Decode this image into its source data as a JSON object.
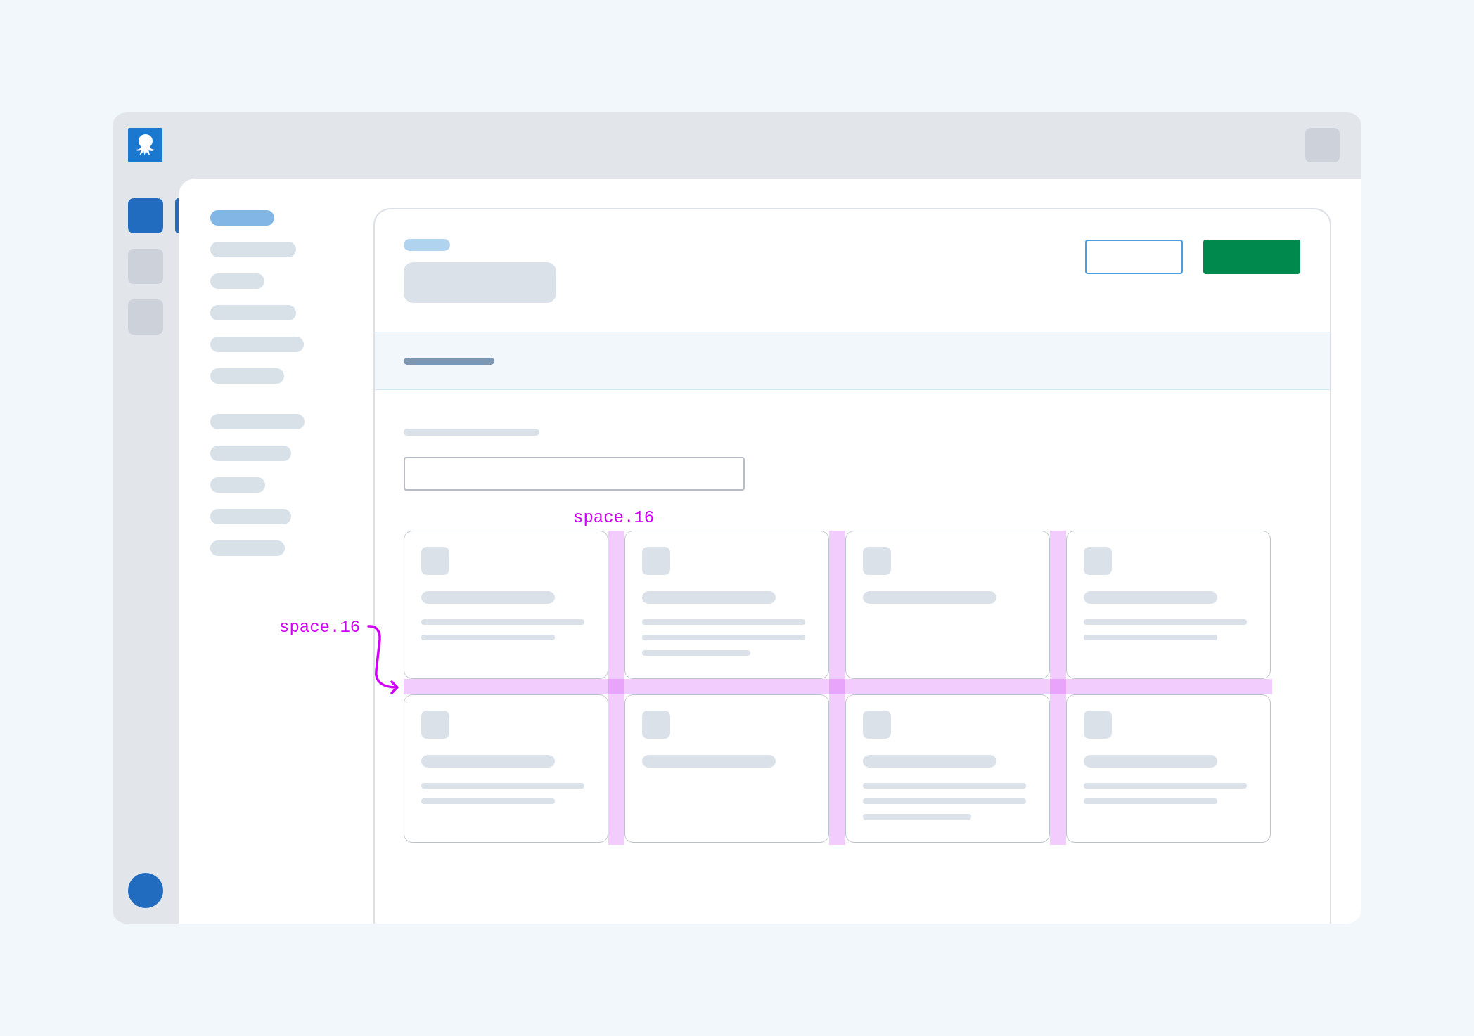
{
  "rail": {
    "items": [
      {
        "selected": true
      },
      {
        "selected": false
      },
      {
        "selected": false
      }
    ]
  },
  "sidebar": {
    "groups": [
      {
        "items": [
          {
            "selected": true
          },
          {
            "selected": false
          },
          {
            "selected": false
          },
          {
            "selected": false
          },
          {
            "selected": false
          },
          {
            "selected": false
          }
        ]
      },
      {
        "items": [
          {
            "selected": false
          },
          {
            "selected": false
          },
          {
            "selected": false
          },
          {
            "selected": false
          },
          {
            "selected": false
          }
        ]
      }
    ]
  },
  "main": {
    "cards": [
      {
        "kind": "short"
      },
      {
        "kind": "long"
      },
      {
        "kind": "bare"
      },
      {
        "kind": "short"
      },
      {
        "kind": "short"
      },
      {
        "kind": "bare"
      },
      {
        "kind": "long"
      },
      {
        "kind": "short"
      }
    ],
    "column_gap": {
      "label": "space.16"
    },
    "row_gap": {
      "label": "space.16"
    }
  }
}
